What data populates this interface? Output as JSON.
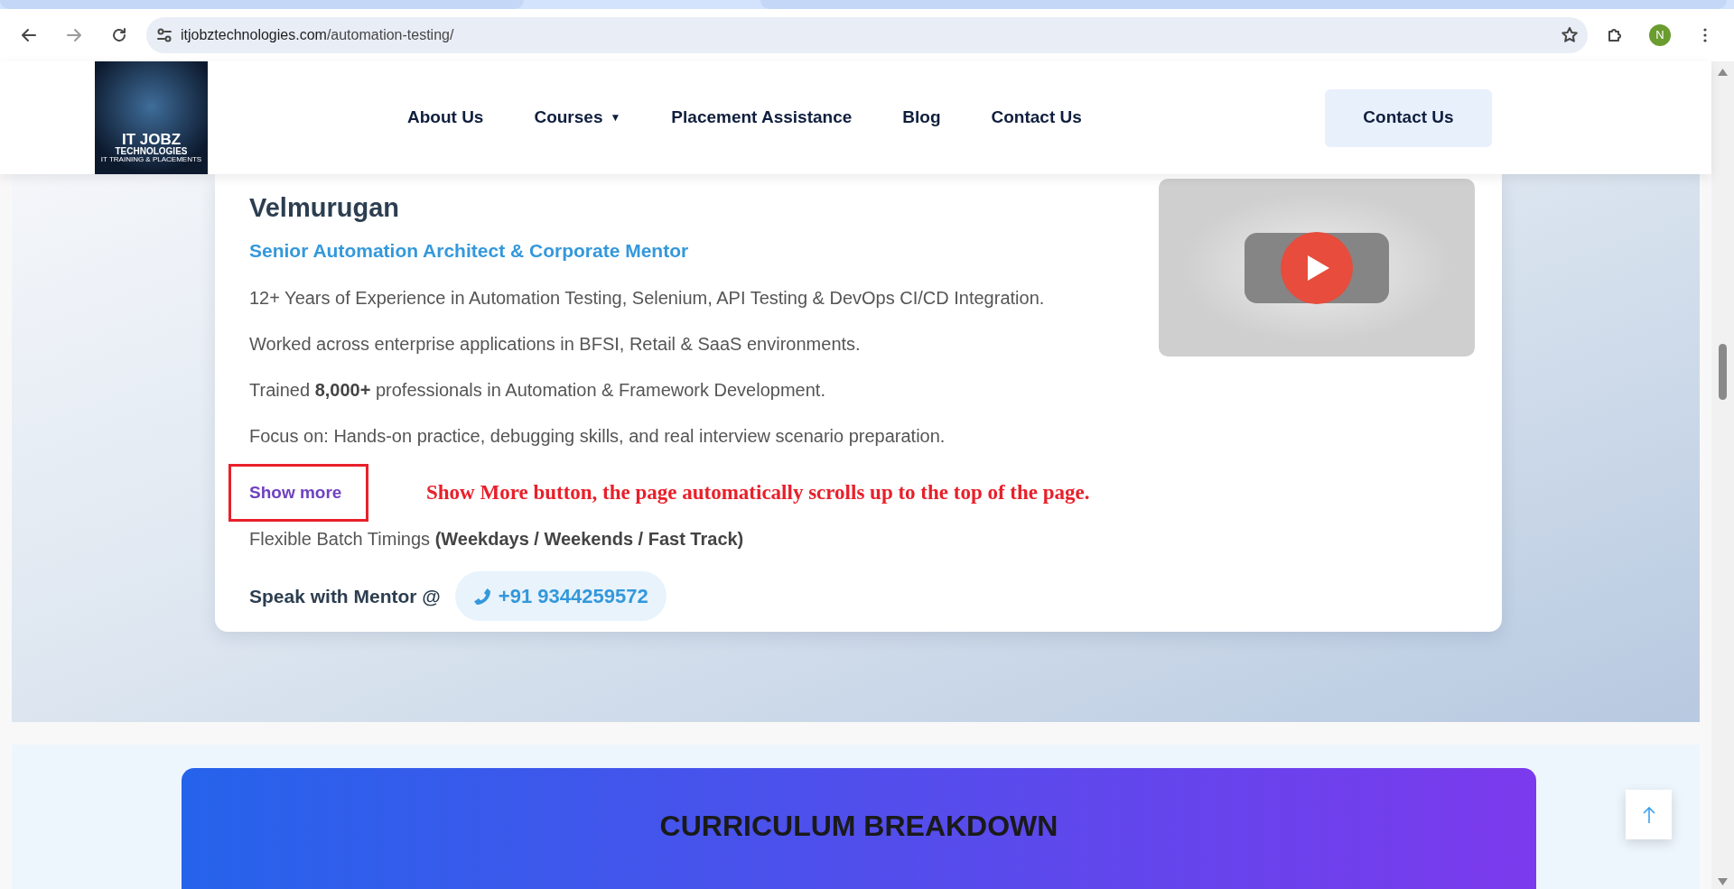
{
  "browser": {
    "url_host": "itjobztechnologies.com",
    "url_path": "/automation-testing/",
    "avatar": "N"
  },
  "header": {
    "logo": {
      "lines": [
        "IT JOBZ",
        "TECHNOLOGIES",
        "IT TRAINING & PLACEMENTS"
      ]
    },
    "nav": [
      {
        "label": "About Us"
      },
      {
        "label": "Courses",
        "caret": "▼"
      },
      {
        "label": "Placement Assistance"
      },
      {
        "label": "Blog"
      },
      {
        "label": "Contact Us"
      }
    ],
    "cta": "Contact Us"
  },
  "mentor": {
    "name": "Velmurugan",
    "title": "Senior Automation Architect & Corporate Mentor",
    "paragraphs": [
      "12+ Years of Experience in Automation Testing, Selenium, API Testing & DevOps CI/CD Integration.",
      "Worked across enterprise applications in BFSI, Retail & SaaS environments.",
      "Trained **8,000+** professionals in Automation & Framework Development.",
      "Focus on: Hands-on practice, debugging skills, and real interview scenario preparation."
    ],
    "show_more": "Show more",
    "batch": "Flexible Batch Timings **(Weekdays / Weekends / Fast Track)**",
    "speak": "Speak with Mentor @",
    "phone": "+91 9344259572"
  },
  "annotation": "Show More button, the page automatically scrolls up to the top of the page.",
  "curriculum": {
    "title": "CURRICULUM BREAKDOWN"
  }
}
